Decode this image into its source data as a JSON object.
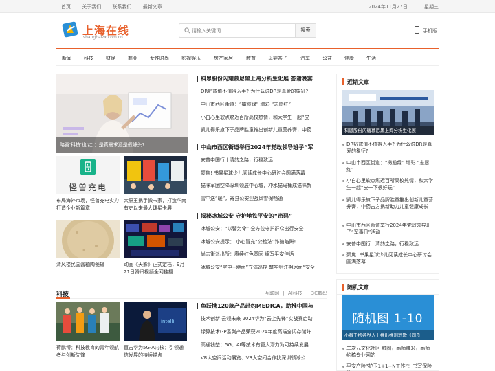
{
  "topbar": {
    "links": [
      "首页",
      "关于我们",
      "联系我们",
      "最新文章"
    ],
    "date": "2024年11月27日",
    "weekday": "星期三"
  },
  "header": {
    "logo_text": "上海在线",
    "logo_sub": "shanghaizx.com.cn",
    "search_placeholder": "请输入关键词",
    "search_button": "搜索",
    "mobile_label": "手机版"
  },
  "nav": [
    "新闻",
    "科技",
    "财经",
    "商业",
    "女性时尚",
    "影视娱乐",
    "房产家居",
    "教育",
    "母婴亲子",
    "汽车",
    "公益",
    "健康",
    "生活"
  ],
  "featured": {
    "hero_caption": "略窗'科技'也'红'：是真需求还是假噱头?",
    "thumbs": [
      {
        "label": "怪兽充电",
        "caption": "布局海外市场，怪兽充电实力打造企业新篇章"
      },
      {
        "caption": "大屏王携手微卡家，打造华南有史以来最大球星卡展"
      },
      {
        "caption": "清风楼民国酱釉陶瓷罐"
      },
      {
        "caption": "动画《天影》正式定档，9月21日腾讯视频全网独播"
      }
    ]
  },
  "news_groups": [
    {
      "headline": "科恩股份闪耀慕尼黑上海分析生化展 答谢晚宴",
      "items": [
        "DR钻戒值不值得入手? 为什么说DR是真爱的象征?",
        "中山市西区街道：“橄榄绿” 增彩 “志愿红”",
        "小白心里软点燃近百所高校热情，和大学生一起“皮",
        "凯儿得乐旗下子品牌胜童推出创新儿童营养膏，中药"
      ]
    },
    {
      "headline": "中山市西区街道举行2024年党政领导班子“军",
      "items": [
        "安普中国行丨清韵之路，行稳致远",
        "聚焦! 书果星球少儿阅读成长中心研讨会圆满落幕",
        "猫咪军团空降深圳领展中心城，冲水猫马桶成猫咪新",
        "雪中送“暖”，寄县公安迎战风雪保畅通"
      ]
    },
    {
      "headline": "揭秘冰城公安 守护地铁平安的“密码”",
      "items": [
        "冰城公安：“以警为令” 全方位守护群众出行安全",
        "冰城公安提示： 小心冒充“公检法”诈骗陷阱!",
        "尚志街派出所：赓续红色基因 续写平安佳话",
        "冰城公安“空中+地面”立体巡控 筑牢封江期冰面“安全"
      ]
    }
  ],
  "tech": {
    "title": "科技",
    "links": [
      "互联网",
      "AI科技",
      "3C数码"
    ],
    "thumbs": [
      {
        "caption": "荷鹏博：科技教育的青年领航者与创新先锋"
      },
      {
        "caption": "直击华为5G-A内核：引领通信发展的持续锚点"
      }
    ],
    "headline": "鱼跃携120款产品赴约MEDICA，助推中国与",
    "items": [
      "技术创新 云领未来 2024华为“云上先锋”实战赛启动",
      "绿算技术GP系列产品荣获2024年度高端全闪存储阵",
      "高通钱堃：5G、AI等技术有更大潜力为可持续发展",
      "VR大空间活动展览、VR大空间合作找深圳领潮公"
    ]
  },
  "sidebar": {
    "latest": {
      "title": "近期文章",
      "image_caption": "科恩股份闪耀慕尼黑上海分析生化展",
      "items": [
        "DR钻戒值不值得入手? 为什么说DR是真爱的象征?",
        "中山市西区街道：“橄榄绿” 增彩 “志愿红”",
        "小白心里软点燃近百所高校热情，和大学生一起“皮一下很好玩”",
        "凯儿得乐旗下子品牌胜童推出创新儿童营养膏，中药古方携新助力儿童健康成长",
        "中山市西区街道举行2024年党政领导班子“军事日”活动",
        "安普中国行丨清韵之路，行稳致远",
        "聚焦! 书果星球少儿阅读成长中心研讨会圆满落幕"
      ]
    },
    "random": {
      "title": "随机文章",
      "image_title": "随机图 1-10",
      "image_caption": "小番王携各界人士推出推剖戏歌《同舟",
      "items": [
        "二次元文化社区·触圈，画师赚米，画师约稿专业网站",
        "平安产险“护卫1+1+N工作”：书写保险的"
      ]
    }
  },
  "colors": {
    "accent": "#e8612c",
    "logo_blue": "#2a8fd6"
  }
}
